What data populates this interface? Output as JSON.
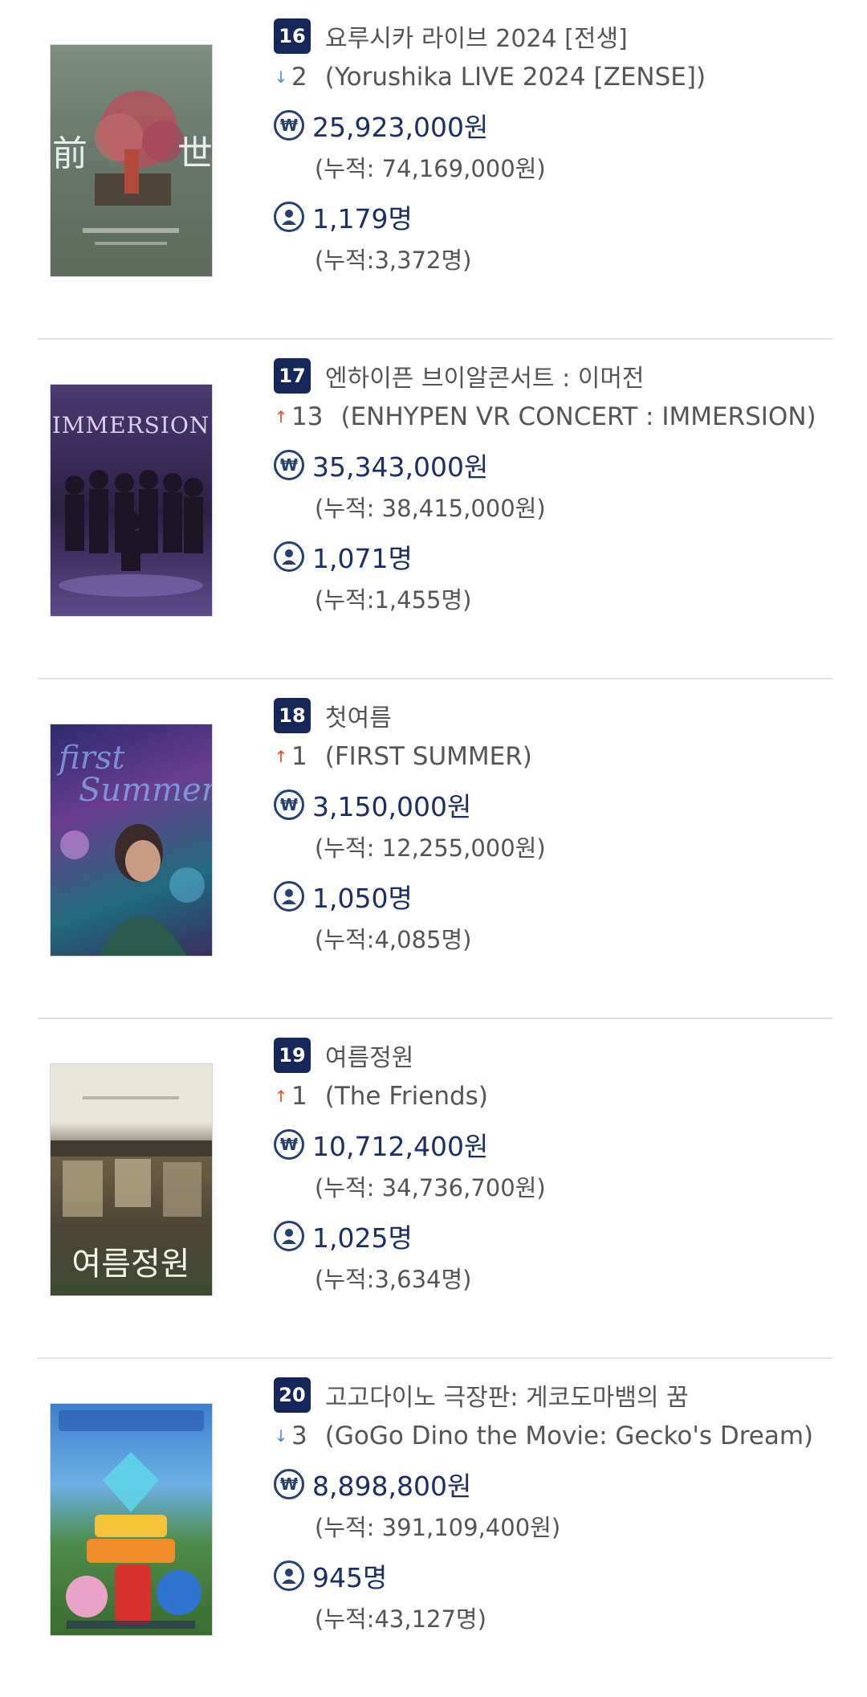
{
  "entries": [
    {
      "rank": "16",
      "title_ko": "요루시카 라이브 2024 [전생]",
      "change_dir": "down",
      "change_num": "2",
      "title_en": "(Yorushika LIVE 2024 [ZENSE])",
      "sales": "25,923,000원",
      "sales_cum": "(누적: 74,169,000원)",
      "audience": "1,179명",
      "audience_cum": "(누적:3,372명)",
      "poster_bg": "#6f7f6f"
    },
    {
      "rank": "17",
      "title_ko": "엔하이픈 브이알콘서트 : 이머전",
      "change_dir": "up",
      "change_num": "13",
      "title_en": "(ENHYPEN VR CONCERT : IMMERSION)",
      "sales": "35,343,000원",
      "sales_cum": "(누적: 38,415,000원)",
      "audience": "1,071명",
      "audience_cum": "(누적:1,455명)",
      "poster_bg": "#3a2b55"
    },
    {
      "rank": "18",
      "title_ko": "첫여름",
      "change_dir": "up",
      "change_num": "1",
      "title_en": "(FIRST SUMMER)",
      "sales": "3,150,000원",
      "sales_cum": "(누적: 12,255,000원)",
      "audience": "1,050명",
      "audience_cum": "(누적:4,085명)",
      "poster_bg": "#3b3f8a"
    },
    {
      "rank": "19",
      "title_ko": "여름정원",
      "change_dir": "up",
      "change_num": "1",
      "title_en": "(The Friends)",
      "sales": "10,712,400원",
      "sales_cum": "(누적: 34,736,700원)",
      "audience": "1,025명",
      "audience_cum": "(누적:3,634명)",
      "poster_bg": "#6f6a4e"
    },
    {
      "rank": "20",
      "title_ko": "고고다이노 극장판: 게코도마뱀의 꿈",
      "change_dir": "down",
      "change_num": "3",
      "title_en": "(GoGo Dino the Movie: Gecko's Dream)",
      "sales": "8,898,800원",
      "sales_cum": "(누적: 391,109,400원)",
      "audience": "945명",
      "audience_cum": "(누적:43,127명)",
      "poster_bg": "#2f6fb0"
    }
  ],
  "icons": {
    "down_arrow": "arrow-down-icon",
    "up_arrow": "arrow-up-icon",
    "won": "won-icon",
    "person": "person-icon"
  },
  "colors": {
    "badge": "#15275a",
    "value_text": "#1c2e63",
    "down": "#4d8fd8",
    "up": "#e6492d"
  }
}
